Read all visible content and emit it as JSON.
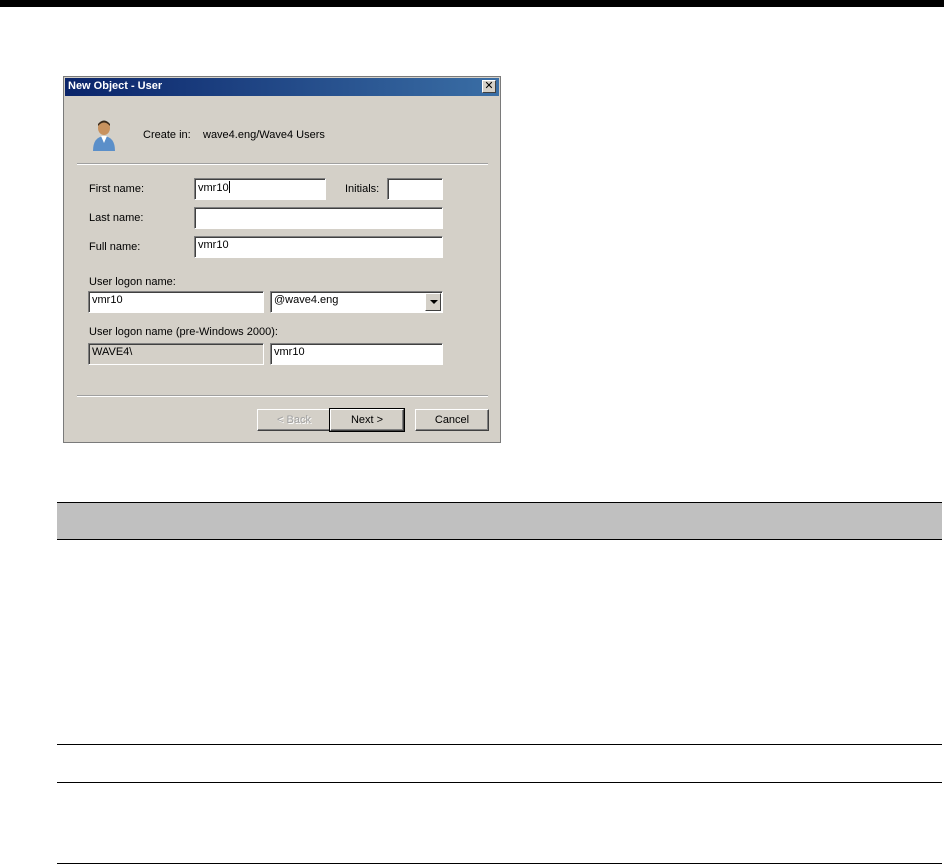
{
  "dialog": {
    "title": "New Object - User",
    "close_glyph": "✕",
    "icon": "user-icon",
    "create_in_label": "Create in:",
    "create_in_path": "wave4.eng/Wave4 Users",
    "first_name_label": "First name:",
    "first_name_value": "vmr10",
    "initials_label": "Initials:",
    "initials_value": "",
    "last_name_label": "Last name:",
    "last_name_value": "",
    "full_name_label": "Full name:",
    "full_name_value": "vmr10",
    "logon_name_label": "User logon name:",
    "logon_name_value": "vmr10",
    "domain_selected": "@wave4.eng",
    "pre2000_label": "User logon name (pre-Windows 2000):",
    "pre2000_domain": "WAVE4\\",
    "pre2000_name": "vmr10",
    "back_label": "< Back",
    "next_label": "Next >",
    "cancel_label": "Cancel"
  }
}
